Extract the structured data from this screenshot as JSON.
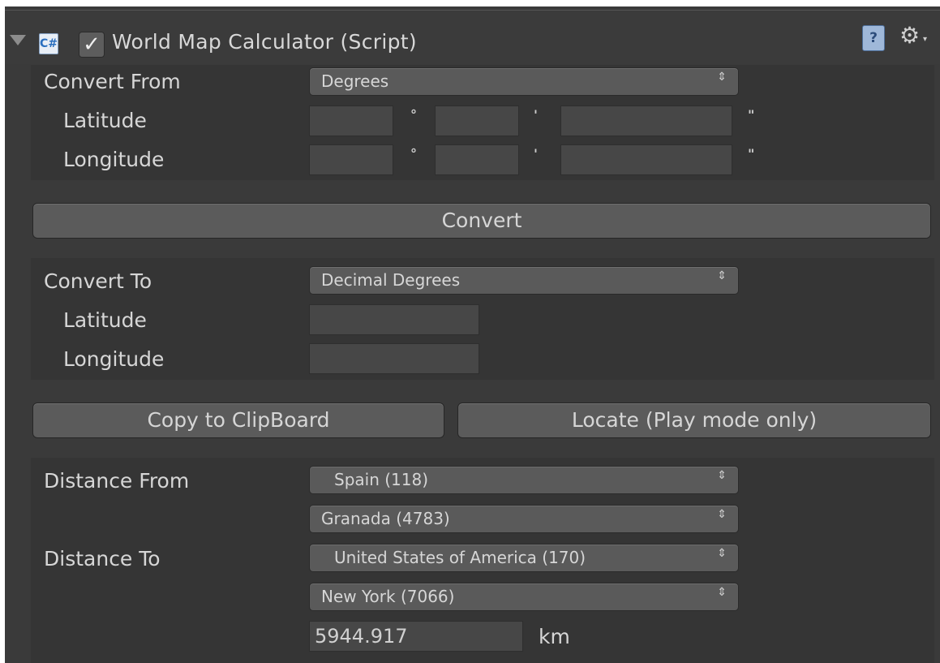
{
  "header": {
    "script_icon": "C#",
    "enabled_check": "✓",
    "title": "World Map Calculator (Script)",
    "help_icon": "?",
    "gear_icon": "⚙"
  },
  "convert_from": {
    "label": "Convert From",
    "mode": "Degrees",
    "latitude_label": "Latitude",
    "longitude_label": "Longitude",
    "degree_symbol": "°",
    "minute_symbol": "'",
    "second_symbol": "\"",
    "latitude_values": [
      "",
      "",
      ""
    ],
    "longitude_values": [
      "",
      "",
      ""
    ]
  },
  "convert_button": "Convert",
  "convert_to": {
    "label": "Convert To",
    "mode": "Decimal Degrees",
    "latitude_label": "Latitude",
    "longitude_label": "Longitude",
    "latitude_value": "",
    "longitude_value": ""
  },
  "actions": {
    "copy_label": "Copy to ClipBoard",
    "locate_label": "Locate (Play mode only)"
  },
  "distance": {
    "from_label": "Distance From",
    "from_country": "Spain (118)",
    "from_city": "Granada (4783)",
    "to_label": "Distance To",
    "to_country": "United States of America (170)",
    "to_city": "New York (7066)",
    "result": "5944.917",
    "unit": "km"
  },
  "dropdown_arrow": "⇕"
}
